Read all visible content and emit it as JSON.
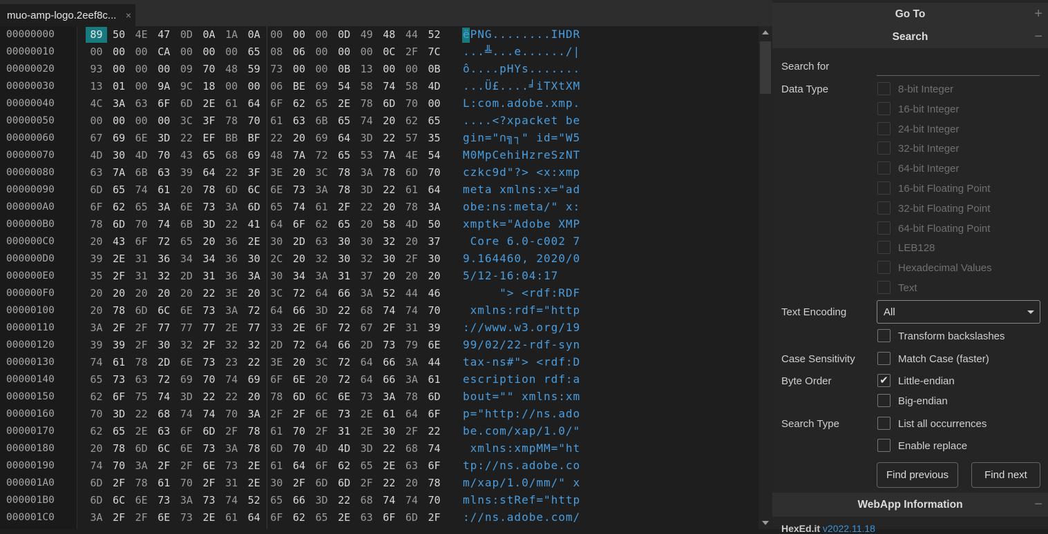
{
  "tab": {
    "title": "muo-amp-logo.2eef8c...",
    "close": "×"
  },
  "hex_rows": [
    {
      "offset": "00000000",
      "bytes": "89 50 4E 47 0D 0A 1A 0A 00 00 00 0D 49 48 44 52",
      "ascii": "ëPNG........IHDR"
    },
    {
      "offset": "00000010",
      "bytes": "00 00 00 CA 00 00 00 65 08 06 00 00 00 0C 2F 7C",
      "ascii": "...╩...e....../|"
    },
    {
      "offset": "00000020",
      "bytes": "93 00 00 00 09 70 48 59 73 00 00 0B 13 00 00 0B",
      "ascii": "ô....pHYs......."
    },
    {
      "offset": "00000030",
      "bytes": "13 01 00 9A 9C 18 00 00 06 BE 69 54 58 74 58 4D",
      "ascii": "...Ü£....╛iTXtXM"
    },
    {
      "offset": "00000040",
      "bytes": "4C 3A 63 6F 6D 2E 61 64 6F 62 65 2E 78 6D 70 00",
      "ascii": "L:com.adobe.xmp."
    },
    {
      "offset": "00000050",
      "bytes": "00 00 00 00 3C 3F 78 70 61 63 6B 65 74 20 62 65",
      "ascii": "....<?xpacket be"
    },
    {
      "offset": "00000060",
      "bytes": "67 69 6E 3D 22 EF BB BF 22 20 69 64 3D 22 57 35",
      "ascii": "gin=\"∩╗┐\" id=\"W5"
    },
    {
      "offset": "00000070",
      "bytes": "4D 30 4D 70 43 65 68 69 48 7A 72 65 53 7A 4E 54",
      "ascii": "M0MpCehiHzreSzNT"
    },
    {
      "offset": "00000080",
      "bytes": "63 7A 6B 63 39 64 22 3F 3E 20 3C 78 3A 78 6D 70",
      "ascii": "czkc9d\"?> <x:xmp"
    },
    {
      "offset": "00000090",
      "bytes": "6D 65 74 61 20 78 6D 6C 6E 73 3A 78 3D 22 61 64",
      "ascii": "meta xmlns:x=\"ad"
    },
    {
      "offset": "000000A0",
      "bytes": "6F 62 65 3A 6E 73 3A 6D 65 74 61 2F 22 20 78 3A",
      "ascii": "obe:ns:meta/\" x:"
    },
    {
      "offset": "000000B0",
      "bytes": "78 6D 70 74 6B 3D 22 41 64 6F 62 65 20 58 4D 50",
      "ascii": "xmptk=\"Adobe XMP"
    },
    {
      "offset": "000000C0",
      "bytes": "20 43 6F 72 65 20 36 2E 30 2D 63 30 30 32 20 37",
      "ascii": " Core 6.0-c002 7"
    },
    {
      "offset": "000000D0",
      "bytes": "39 2E 31 36 34 34 36 30 2C 20 32 30 32 30 2F 30",
      "ascii": "9.164460, 2020/0"
    },
    {
      "offset": "000000E0",
      "bytes": "35 2F 31 32 2D 31 36 3A 30 34 3A 31 37 20 20 20",
      "ascii": "5/12-16:04:17   "
    },
    {
      "offset": "000000F0",
      "bytes": "20 20 20 20 20 22 3E 20 3C 72 64 66 3A 52 44 46",
      "ascii": "     \"> <rdf:RDF"
    },
    {
      "offset": "00000100",
      "bytes": "20 78 6D 6C 6E 73 3A 72 64 66 3D 22 68 74 74 70",
      "ascii": " xmlns:rdf=\"http"
    },
    {
      "offset": "00000110",
      "bytes": "3A 2F 2F 77 77 77 2E 77 33 2E 6F 72 67 2F 31 39",
      "ascii": "://www.w3.org/19"
    },
    {
      "offset": "00000120",
      "bytes": "39 39 2F 30 32 2F 32 32 2D 72 64 66 2D 73 79 6E",
      "ascii": "99/02/22-rdf-syn"
    },
    {
      "offset": "00000130",
      "bytes": "74 61 78 2D 6E 73 23 22 3E 20 3C 72 64 66 3A 44",
      "ascii": "tax-ns#\"> <rdf:D"
    },
    {
      "offset": "00000140",
      "bytes": "65 73 63 72 69 70 74 69 6F 6E 20 72 64 66 3A 61",
      "ascii": "escription rdf:a"
    },
    {
      "offset": "00000150",
      "bytes": "62 6F 75 74 3D 22 22 20 78 6D 6C 6E 73 3A 78 6D",
      "ascii": "bout=\"\" xmlns:xm"
    },
    {
      "offset": "00000160",
      "bytes": "70 3D 22 68 74 74 70 3A 2F 2F 6E 73 2E 61 64 6F",
      "ascii": "p=\"http://ns.ado"
    },
    {
      "offset": "00000170",
      "bytes": "62 65 2E 63 6F 6D 2F 78 61 70 2F 31 2E 30 2F 22",
      "ascii": "be.com/xap/1.0/\""
    },
    {
      "offset": "00000180",
      "bytes": "20 78 6D 6C 6E 73 3A 78 6D 70 4D 4D 3D 22 68 74",
      "ascii": " xmlns:xmpMM=\"ht"
    },
    {
      "offset": "00000190",
      "bytes": "74 70 3A 2F 2F 6E 73 2E 61 64 6F 62 65 2E 63 6F",
      "ascii": "tp://ns.adobe.co"
    },
    {
      "offset": "000001A0",
      "bytes": "6D 2F 78 61 70 2F 31 2E 30 2F 6D 6D 2F 22 20 78",
      "ascii": "m/xap/1.0/mm/\" x"
    },
    {
      "offset": "000001B0",
      "bytes": "6D 6C 6E 73 3A 73 74 52 65 66 3D 22 68 74 74 70",
      "ascii": "mlns:stRef=\"http"
    },
    {
      "offset": "000001C0",
      "bytes": "3A 2F 2F 6E 73 2E 61 64 6F 62 65 2E 63 6F 6D 2F",
      "ascii": "://ns.adobe.com/"
    }
  ],
  "panel": {
    "goto": {
      "title": "Go To",
      "toggle": "+"
    },
    "search": {
      "title": "Search",
      "toggle": "−",
      "search_for_label": "Search for",
      "search_for_value": "",
      "data_type_label": "Data Type",
      "data_types": [
        "8-bit Integer",
        "16-bit Integer",
        "24-bit Integer",
        "32-bit Integer",
        "64-bit Integer",
        "16-bit Floating Point",
        "32-bit Floating Point",
        "64-bit Floating Point",
        "LEB128",
        "Hexadecimal Values",
        "Text"
      ],
      "text_encoding_label": "Text Encoding",
      "text_encoding_value": "All",
      "transform_backslashes": "Transform backslashes",
      "case_label": "Case Sensitivity",
      "match_case": "Match Case (faster)",
      "byte_order_label": "Byte Order",
      "little_endian": "Little-endian",
      "big_endian": "Big-endian",
      "check": "✔",
      "search_type_label": "Search Type",
      "list_all": "List all occurrences",
      "enable_replace": "Enable replace",
      "find_previous": "Find previous",
      "find_next": "Find next"
    },
    "webapp": {
      "title": "WebApp Information",
      "toggle": "−",
      "app_name": "HexEd.it ",
      "version": "v2022.11.18"
    }
  },
  "colors": {
    "accent": "#177a7f",
    "ascii": "#3f94d6"
  }
}
